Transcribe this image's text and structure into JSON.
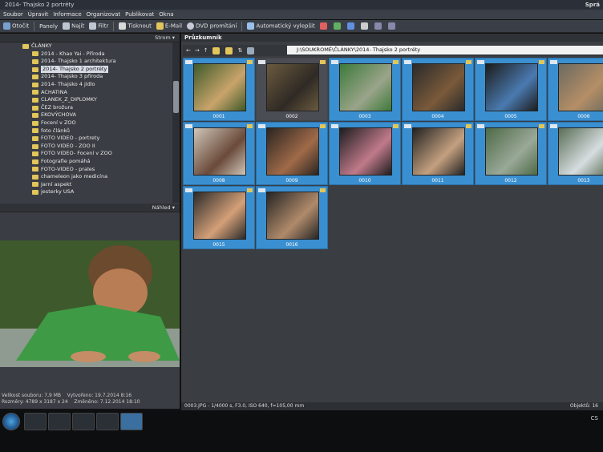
{
  "window": {
    "title": "2014- Thajsko 2 portréty",
    "right_label": "Sprá"
  },
  "menu": [
    "Soubor",
    "Úpravit",
    "Informace",
    "Organizovat",
    "Publikovat",
    "Okna"
  ],
  "toolbar": {
    "items": [
      "Otočit",
      "Panely",
      "Najít",
      "Filtr",
      "Tisknout",
      "E-Mail",
      "DVD promítání",
      "Automatický vylepšit"
    ]
  },
  "folder_panel": {
    "header": "Strom",
    "items": [
      "ČLÁNKY",
      "2014 - Khao Yai - Příroda",
      "2014- Thajsko 1 architektura",
      "2014- Thajsko 2 portréty",
      "2014- Thajsko 3 příroda",
      "2014- Thajsko 4 jídlo",
      "ACHATINA",
      "CLANEK_Z_DIPLOMKY",
      "ČEZ brožura",
      "EKOVÝCHOVA",
      "Focení v ZOO",
      "foto článků",
      "FOTO VIDEO - portrety",
      "FOTO VIDEO - ZOO II",
      "FOTO VIDEO- Focení v ZOO",
      "Fotografie pomáhá",
      "FOTO-VIDEO - prales",
      "chameleon jako medicína",
      "Jarní aspekt",
      "jesterky USA"
    ],
    "selected_index": 3
  },
  "preview_panel": {
    "header": "Náhled",
    "info_left": [
      "Velikost souboru: 7,9 MB",
      "Rozměry: 4789 x 3187 x 24"
    ],
    "info_right": [
      "Vytvořeno: 19.7.2014 8:16",
      "Změněno: 7.12.2014 18:10"
    ]
  },
  "browser": {
    "title": "Průzkumník",
    "path": "J:\\SOUKROMÉ\\ČLÁNKY\\2014- Thajsko 2 portréty",
    "thumbnails": [
      {
        "num": "0001",
        "selected": true,
        "c1": "#3f5a2a",
        "c2": "#c9a46b"
      },
      {
        "num": "0002",
        "selected": false,
        "c1": "#6b5a3e",
        "c2": "#2f2a25"
      },
      {
        "num": "0003",
        "selected": true,
        "c1": "#3d7a3a",
        "c2": "#9aa48a"
      },
      {
        "num": "0004",
        "selected": true,
        "c1": "#2a2a2a",
        "c2": "#7a5a3a"
      },
      {
        "num": "0005",
        "selected": true,
        "c1": "#1c1c1c",
        "c2": "#4a7ab0"
      },
      {
        "num": "0006",
        "selected": true,
        "c1": "#6b6a60",
        "c2": "#b58e66"
      },
      {
        "num": "0008",
        "selected": true,
        "c1": "#cfc6b8",
        "c2": "#6a4a3a"
      },
      {
        "num": "0009",
        "selected": true,
        "c1": "#2a2522",
        "c2": "#a06a48"
      },
      {
        "num": "0010",
        "selected": true,
        "c1": "#1d1d1f",
        "c2": "#c07a8a"
      },
      {
        "num": "0011",
        "selected": true,
        "c1": "#222",
        "c2": "#c4a080"
      },
      {
        "num": "0012",
        "selected": true,
        "c1": "#4d6a46",
        "c2": "#9aa898"
      },
      {
        "num": "0013",
        "selected": true,
        "c1": "#5a6e56",
        "c2": "#d6dde0"
      },
      {
        "num": "0015",
        "selected": true,
        "c1": "#2a2a2a",
        "c2": "#d4a078"
      },
      {
        "num": "0016",
        "selected": true,
        "c1": "#252525",
        "c2": "#b08a6a"
      }
    ]
  },
  "statusbar": {
    "left": "0003.JPG - 1/4000 s, F3.0, ISO 640, f=105,00 mm",
    "right": "Objektů: 16"
  },
  "taskbar": {
    "tray": "CS"
  }
}
